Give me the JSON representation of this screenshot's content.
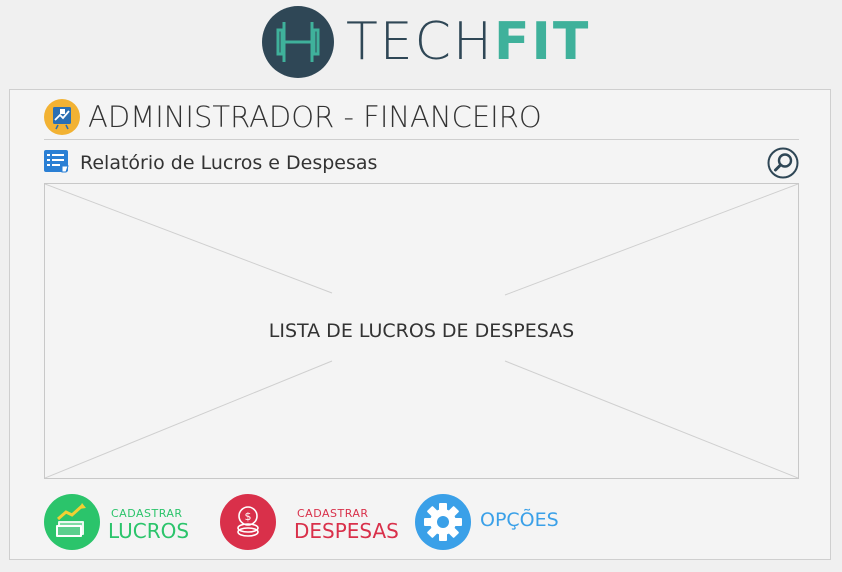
{
  "brand": {
    "name_part1": "TECH",
    "name_part2": "FIT",
    "monogram": "H"
  },
  "header": {
    "title": "ADMINISTRADOR - FINANCEIRO"
  },
  "report": {
    "title": "Relatório de Lucros e Despesas"
  },
  "list": {
    "placeholder": "LISTA DE LUCROS DE DESPESAS"
  },
  "actions": [
    {
      "small": "CADASTRAR",
      "big": "LUCROS",
      "icon": "money-growth-icon",
      "color": "#2bc46b"
    },
    {
      "small": "CADASTRAR",
      "big": "DESPESAS",
      "icon": "coins-icon",
      "color": "#d9304a"
    },
    {
      "small": "",
      "big": "OPÇÕES",
      "icon": "gear-icon",
      "color": "#3aa0e8"
    }
  ],
  "colors": {
    "brand_dark": "#2f4756",
    "brand_accent": "#3fb19b",
    "admin_icon_bg": "#f2b233"
  }
}
